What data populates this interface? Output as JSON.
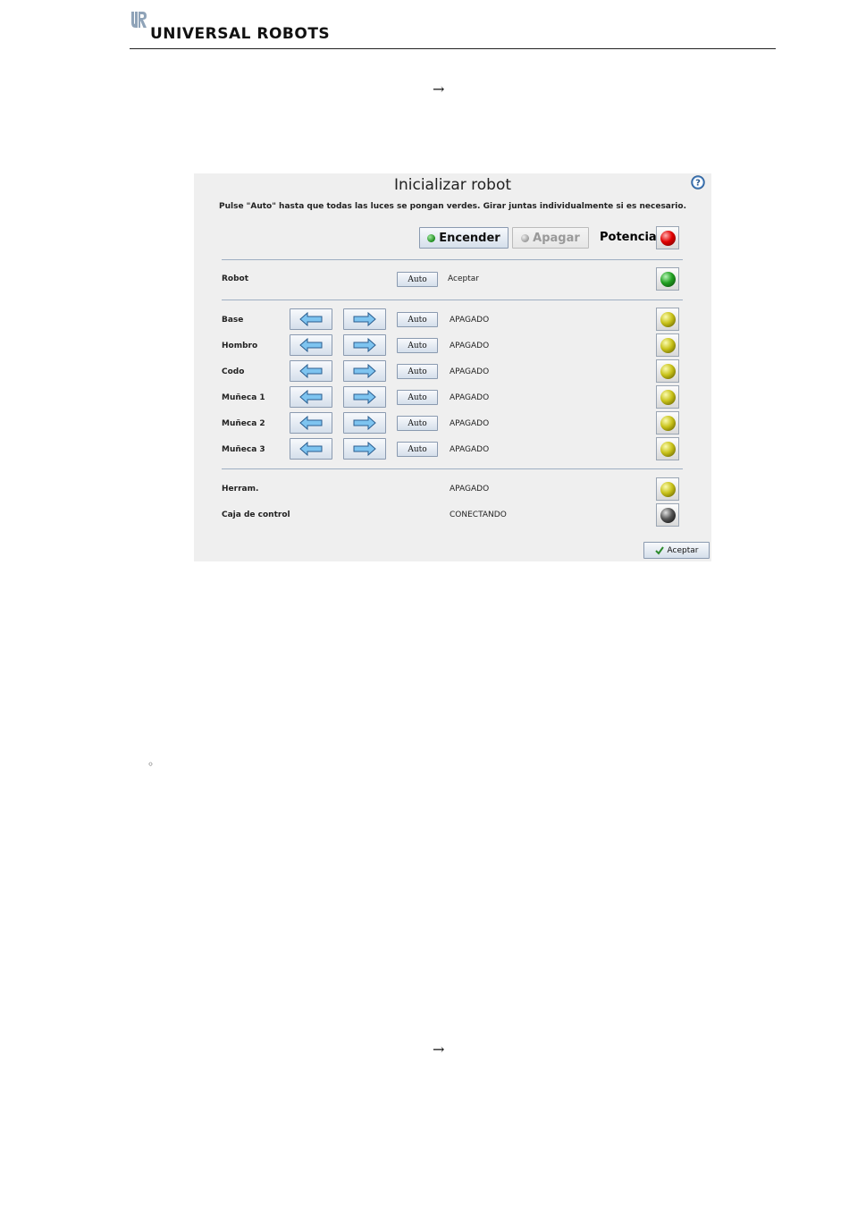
{
  "header": {
    "brand_logo_icon": "ur-logo-icon",
    "brand_name": "UNIVERSAL ROBOTS"
  },
  "document": {
    "arrow_1": "→",
    "bullet": "◦",
    "arrow_2": "→"
  },
  "dialog": {
    "title": "Inicializar robot",
    "subtitle": "Pulse \"Auto\" hasta que todas las luces se pongan verdes. Girar juntas individualmente si es necesario.",
    "help_icon": "question-icon",
    "power_on_label": "Encender",
    "power_off_label": "Apagar",
    "power_label": "Potencia",
    "power_light": "red",
    "robot_row": {
      "label": "Robot",
      "auto_label": "Auto",
      "status": "Aceptar",
      "light": "green"
    },
    "joints": [
      {
        "label": "Base",
        "auto_label": "Auto",
        "status": "APAGADO",
        "light": "yellow"
      },
      {
        "label": "Hombro",
        "auto_label": "Auto",
        "status": "APAGADO",
        "light": "yellow"
      },
      {
        "label": "Codo",
        "auto_label": "Auto",
        "status": "APAGADO",
        "light": "yellow"
      },
      {
        "label": "Muñeca 1",
        "auto_label": "Auto",
        "status": "APAGADO",
        "light": "yellow"
      },
      {
        "label": "Muñeca 2",
        "auto_label": "Auto",
        "status": "APAGADO",
        "light": "yellow"
      },
      {
        "label": "Muñeca 3",
        "auto_label": "Auto",
        "status": "APAGADO",
        "light": "yellow"
      }
    ],
    "tool_row": {
      "label": "Herram.",
      "status": "APAGADO",
      "light": "yellow"
    },
    "control_row": {
      "label": "Caja de control",
      "status": "CONECTANDO",
      "light": "grey"
    },
    "accept_label": "Aceptar",
    "colors": {
      "background": "#efefef",
      "separator": "#9eaec2",
      "arrow_fill": "#7ec4f0"
    }
  }
}
